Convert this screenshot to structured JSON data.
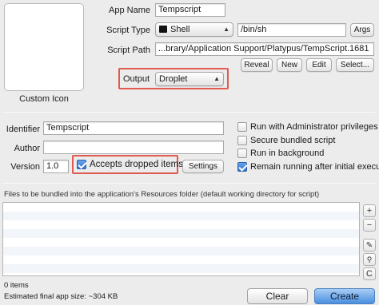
{
  "icon": {
    "label": "Custom Icon"
  },
  "app": {
    "name_label": "App Name",
    "name_value": "Tempscript",
    "script_type_label": "Script Type",
    "script_type_value": "Shell",
    "interpreter_value": "/bin/sh",
    "args_label": "Args",
    "script_path_label": "Script Path",
    "script_path_value": "...brary/Application Support/Platypus/TempScript.1681",
    "reveal_label": "Reveal",
    "new_label": "New",
    "edit_label": "Edit",
    "select_label": "Select...",
    "output_label": "Output",
    "output_value": "Droplet"
  },
  "info": {
    "identifier_label": "Identifier",
    "identifier_value": "Tempscript",
    "author_label": "Author",
    "author_value": "",
    "version_label": "Version",
    "version_value": "1.0",
    "accepts_dropped_label": "Accepts dropped items",
    "settings_label": "Settings"
  },
  "options": [
    {
      "label": "Run with Administrator privileges",
      "checked": false
    },
    {
      "label": "Secure bundled script",
      "checked": false
    },
    {
      "label": "Run in background",
      "checked": false
    },
    {
      "label": "Remain running after initial execution",
      "checked": true
    }
  ],
  "bundle": {
    "header": "Files to be bundled into the application's Resources folder (default working directory for script)",
    "count": "0 items",
    "size": "Estimated final app size: ~304 KB",
    "add_glyph": "+",
    "remove_glyph": "−",
    "clear_glyph": "C"
  },
  "footer": {
    "clear_label": "Clear",
    "create_label": "Create"
  },
  "colors": {
    "highlight": "#e05a4f",
    "accent": "#4a8fe0"
  }
}
